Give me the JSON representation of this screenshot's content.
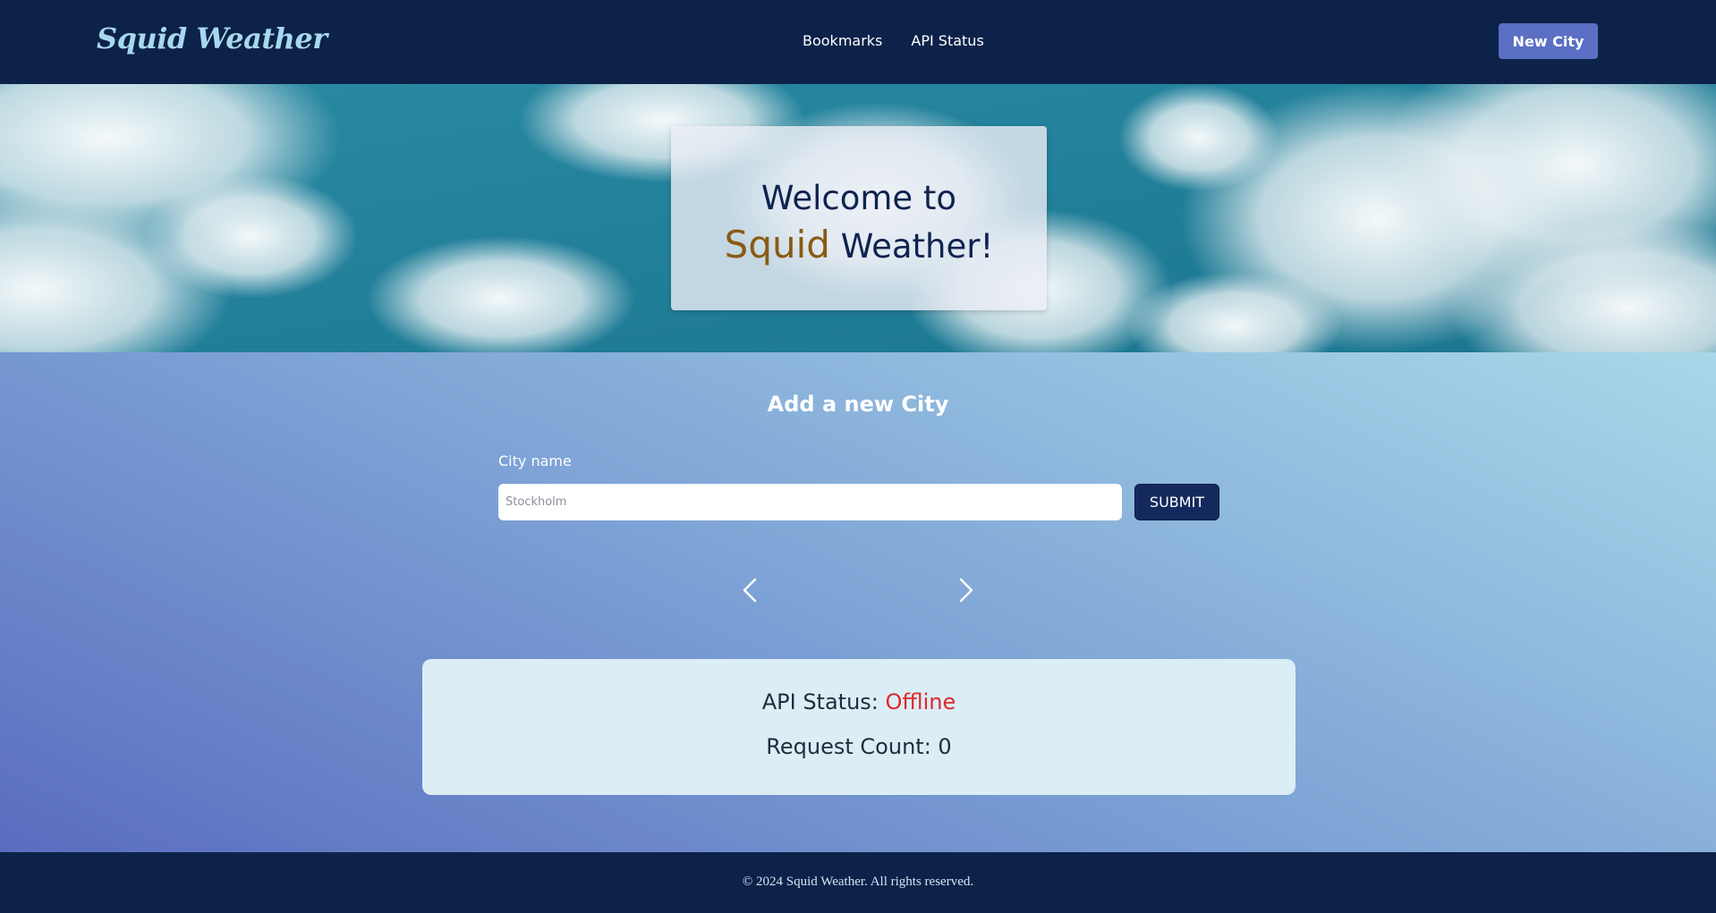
{
  "header": {
    "logo": "Squid Weather",
    "nav": [
      {
        "label": "Bookmarks"
      },
      {
        "label": "API Status"
      }
    ],
    "cta_label": "New City"
  },
  "hero": {
    "line1": "Welcome to",
    "line2_accent": "Squid",
    "line2_rest": " Weather!"
  },
  "form": {
    "title": "Add a new City",
    "label": "City name",
    "placeholder": "Stockholm",
    "value": "",
    "submit_label": "SUBMIT"
  },
  "carousel": {
    "prev_icon": "chevron-left-icon",
    "next_icon": "chevron-right-icon"
  },
  "status": {
    "api_label": "API Status: ",
    "api_value": "Offline",
    "request_label": "Request Count: ",
    "request_count": "0"
  },
  "footer": {
    "text": "© 2024 Squid Weather. All rights reserved."
  },
  "colors": {
    "navy": "#0c2249",
    "logo": "#a8d8ee",
    "button": "#5b6fc4",
    "accent": "#8a5a12",
    "offline": "#e0272b"
  }
}
